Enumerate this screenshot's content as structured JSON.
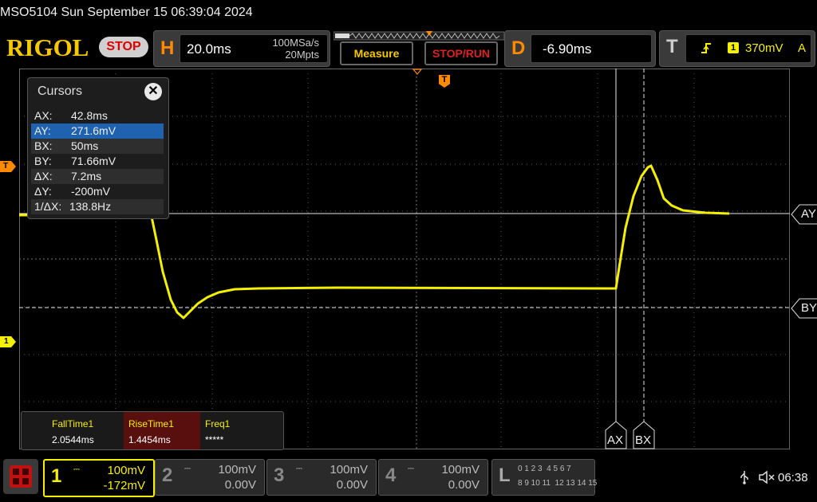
{
  "status": {
    "model_datetime": "MSO5104  Sun September 15 06:39:04 2024"
  },
  "header": {
    "logo": "RIGOL",
    "run_state": "STOP",
    "horizontal": {
      "letter": "H",
      "timebase": "20.0ms",
      "sample_rate": "100MSa/s",
      "memory_depth": "20Mpts"
    },
    "measure_label": "Measure",
    "stop_run_label": "STOP/RUN",
    "delay": {
      "letter": "D",
      "value": "-6.90ms"
    },
    "trigger": {
      "letter": "T",
      "channel": "1",
      "level": "370mV",
      "mode": "A"
    }
  },
  "waveform": {
    "markers": {
      "trigger_level": "T",
      "channel1": "1",
      "trigger_pos": "T"
    },
    "cursor_labels": {
      "ay": "AY",
      "by": "BY",
      "ax": "AX",
      "bx": "BX"
    }
  },
  "cursors_panel": {
    "title": "Cursors",
    "close": "✕",
    "rows": [
      {
        "key": "AX:",
        "value": "42.8ms"
      },
      {
        "key": "AY:",
        "value": "271.6mV"
      },
      {
        "key": "BX:",
        "value": "50ms"
      },
      {
        "key": "BY:",
        "value": "71.66mV"
      },
      {
        "key": "ΔX:",
        "value": "7.2ms"
      },
      {
        "key": "ΔY:",
        "value": "-200mV"
      },
      {
        "key": "1/ΔX:",
        "value": "138.8Hz"
      }
    ]
  },
  "measurements": [
    {
      "name": "FallTime1",
      "value": "2.0544ms"
    },
    {
      "name": "RiseTime1",
      "value": "1.4454ms"
    },
    {
      "name": "Freq1",
      "value": "*****"
    }
  ],
  "channels": [
    {
      "num": "1",
      "scale": "100mV",
      "offset": "-172mV"
    },
    {
      "num": "2",
      "scale": "100mV",
      "offset": "0.00V"
    },
    {
      "num": "3",
      "scale": "100mV",
      "offset": "0.00V"
    },
    {
      "num": "4",
      "scale": "100mV",
      "offset": "0.00V"
    }
  ],
  "logic": {
    "letter": "L",
    "row1": "0 1 2 3  4 5 6 7",
    "row2": "8 9 10 11  12 13 14 15"
  },
  "system": {
    "time": "06:38"
  },
  "colors": {
    "channel1": "#f5f000",
    "accent_orange": "#ff8a00",
    "stop_red": "#e00000",
    "cursor_select": "#1f62b0"
  }
}
